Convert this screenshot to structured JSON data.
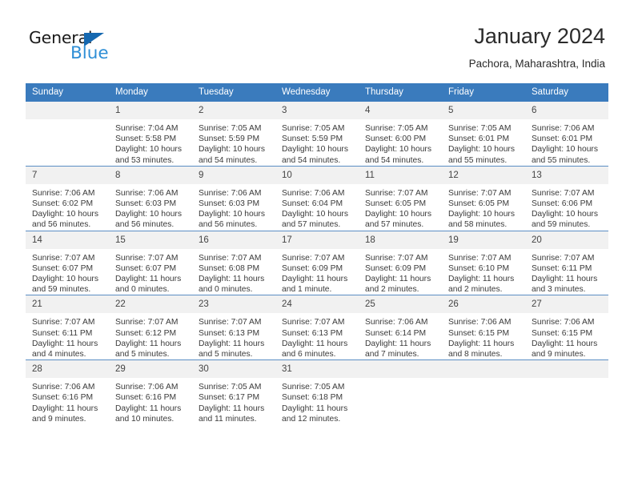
{
  "brand": {
    "name_part1": "General",
    "name_part2": "Blue",
    "triangle_color": "#1568b0",
    "blue_text_color": "#2f8fd6"
  },
  "header": {
    "title": "January 2024",
    "subtitle": "Pachora, Maharashtra, India"
  },
  "theme": {
    "header_bg": "#3a7bbd",
    "header_text": "#ffffff",
    "daynum_bg": "#f1f1f1",
    "rule_color": "#5b8ec4",
    "body_text": "#3a3a3a"
  },
  "weekdays": [
    "Sunday",
    "Monday",
    "Tuesday",
    "Wednesday",
    "Thursday",
    "Friday",
    "Saturday"
  ],
  "calendar": {
    "month": "January",
    "year": "2024",
    "weeks": [
      [
        {
          "day": "",
          "blank": true,
          "l1": "",
          "l2": "",
          "l3": "",
          "l4": ""
        },
        {
          "day": "1",
          "l1": "Sunrise: 7:04 AM",
          "l2": "Sunset: 5:58 PM",
          "l3": "Daylight: 10 hours",
          "l4": "and 53 minutes."
        },
        {
          "day": "2",
          "l1": "Sunrise: 7:05 AM",
          "l2": "Sunset: 5:59 PM",
          "l3": "Daylight: 10 hours",
          "l4": "and 54 minutes."
        },
        {
          "day": "3",
          "l1": "Sunrise: 7:05 AM",
          "l2": "Sunset: 5:59 PM",
          "l3": "Daylight: 10 hours",
          "l4": "and 54 minutes."
        },
        {
          "day": "4",
          "l1": "Sunrise: 7:05 AM",
          "l2": "Sunset: 6:00 PM",
          "l3": "Daylight: 10 hours",
          "l4": "and 54 minutes."
        },
        {
          "day": "5",
          "l1": "Sunrise: 7:05 AM",
          "l2": "Sunset: 6:01 PM",
          "l3": "Daylight: 10 hours",
          "l4": "and 55 minutes."
        },
        {
          "day": "6",
          "l1": "Sunrise: 7:06 AM",
          "l2": "Sunset: 6:01 PM",
          "l3": "Daylight: 10 hours",
          "l4": "and 55 minutes."
        }
      ],
      [
        {
          "day": "7",
          "l1": "Sunrise: 7:06 AM",
          "l2": "Sunset: 6:02 PM",
          "l3": "Daylight: 10 hours",
          "l4": "and 56 minutes."
        },
        {
          "day": "8",
          "l1": "Sunrise: 7:06 AM",
          "l2": "Sunset: 6:03 PM",
          "l3": "Daylight: 10 hours",
          "l4": "and 56 minutes."
        },
        {
          "day": "9",
          "l1": "Sunrise: 7:06 AM",
          "l2": "Sunset: 6:03 PM",
          "l3": "Daylight: 10 hours",
          "l4": "and 56 minutes."
        },
        {
          "day": "10",
          "l1": "Sunrise: 7:06 AM",
          "l2": "Sunset: 6:04 PM",
          "l3": "Daylight: 10 hours",
          "l4": "and 57 minutes."
        },
        {
          "day": "11",
          "l1": "Sunrise: 7:07 AM",
          "l2": "Sunset: 6:05 PM",
          "l3": "Daylight: 10 hours",
          "l4": "and 57 minutes."
        },
        {
          "day": "12",
          "l1": "Sunrise: 7:07 AM",
          "l2": "Sunset: 6:05 PM",
          "l3": "Daylight: 10 hours",
          "l4": "and 58 minutes."
        },
        {
          "day": "13",
          "l1": "Sunrise: 7:07 AM",
          "l2": "Sunset: 6:06 PM",
          "l3": "Daylight: 10 hours",
          "l4": "and 59 minutes."
        }
      ],
      [
        {
          "day": "14",
          "l1": "Sunrise: 7:07 AM",
          "l2": "Sunset: 6:07 PM",
          "l3": "Daylight: 10 hours",
          "l4": "and 59 minutes."
        },
        {
          "day": "15",
          "l1": "Sunrise: 7:07 AM",
          "l2": "Sunset: 6:07 PM",
          "l3": "Daylight: 11 hours",
          "l4": "and 0 minutes."
        },
        {
          "day": "16",
          "l1": "Sunrise: 7:07 AM",
          "l2": "Sunset: 6:08 PM",
          "l3": "Daylight: 11 hours",
          "l4": "and 0 minutes."
        },
        {
          "day": "17",
          "l1": "Sunrise: 7:07 AM",
          "l2": "Sunset: 6:09 PM",
          "l3": "Daylight: 11 hours",
          "l4": "and 1 minute."
        },
        {
          "day": "18",
          "l1": "Sunrise: 7:07 AM",
          "l2": "Sunset: 6:09 PM",
          "l3": "Daylight: 11 hours",
          "l4": "and 2 minutes."
        },
        {
          "day": "19",
          "l1": "Sunrise: 7:07 AM",
          "l2": "Sunset: 6:10 PM",
          "l3": "Daylight: 11 hours",
          "l4": "and 2 minutes."
        },
        {
          "day": "20",
          "l1": "Sunrise: 7:07 AM",
          "l2": "Sunset: 6:11 PM",
          "l3": "Daylight: 11 hours",
          "l4": "and 3 minutes."
        }
      ],
      [
        {
          "day": "21",
          "l1": "Sunrise: 7:07 AM",
          "l2": "Sunset: 6:11 PM",
          "l3": "Daylight: 11 hours",
          "l4": "and 4 minutes."
        },
        {
          "day": "22",
          "l1": "Sunrise: 7:07 AM",
          "l2": "Sunset: 6:12 PM",
          "l3": "Daylight: 11 hours",
          "l4": "and 5 minutes."
        },
        {
          "day": "23",
          "l1": "Sunrise: 7:07 AM",
          "l2": "Sunset: 6:13 PM",
          "l3": "Daylight: 11 hours",
          "l4": "and 5 minutes."
        },
        {
          "day": "24",
          "l1": "Sunrise: 7:07 AM",
          "l2": "Sunset: 6:13 PM",
          "l3": "Daylight: 11 hours",
          "l4": "and 6 minutes."
        },
        {
          "day": "25",
          "l1": "Sunrise: 7:06 AM",
          "l2": "Sunset: 6:14 PM",
          "l3": "Daylight: 11 hours",
          "l4": "and 7 minutes."
        },
        {
          "day": "26",
          "l1": "Sunrise: 7:06 AM",
          "l2": "Sunset: 6:15 PM",
          "l3": "Daylight: 11 hours",
          "l4": "and 8 minutes."
        },
        {
          "day": "27",
          "l1": "Sunrise: 7:06 AM",
          "l2": "Sunset: 6:15 PM",
          "l3": "Daylight: 11 hours",
          "l4": "and 9 minutes."
        }
      ],
      [
        {
          "day": "28",
          "l1": "Sunrise: 7:06 AM",
          "l2": "Sunset: 6:16 PM",
          "l3": "Daylight: 11 hours",
          "l4": "and 9 minutes."
        },
        {
          "day": "29",
          "l1": "Sunrise: 7:06 AM",
          "l2": "Sunset: 6:16 PM",
          "l3": "Daylight: 11 hours",
          "l4": "and 10 minutes."
        },
        {
          "day": "30",
          "l1": "Sunrise: 7:05 AM",
          "l2": "Sunset: 6:17 PM",
          "l3": "Daylight: 11 hours",
          "l4": "and 11 minutes."
        },
        {
          "day": "31",
          "l1": "Sunrise: 7:05 AM",
          "l2": "Sunset: 6:18 PM",
          "l3": "Daylight: 11 hours",
          "l4": "and 12 minutes."
        },
        {
          "day": "",
          "blank": true,
          "l1": "",
          "l2": "",
          "l3": "",
          "l4": ""
        },
        {
          "day": "",
          "blank": true,
          "l1": "",
          "l2": "",
          "l3": "",
          "l4": ""
        },
        {
          "day": "",
          "blank": true,
          "l1": "",
          "l2": "",
          "l3": "",
          "l4": ""
        }
      ]
    ]
  }
}
